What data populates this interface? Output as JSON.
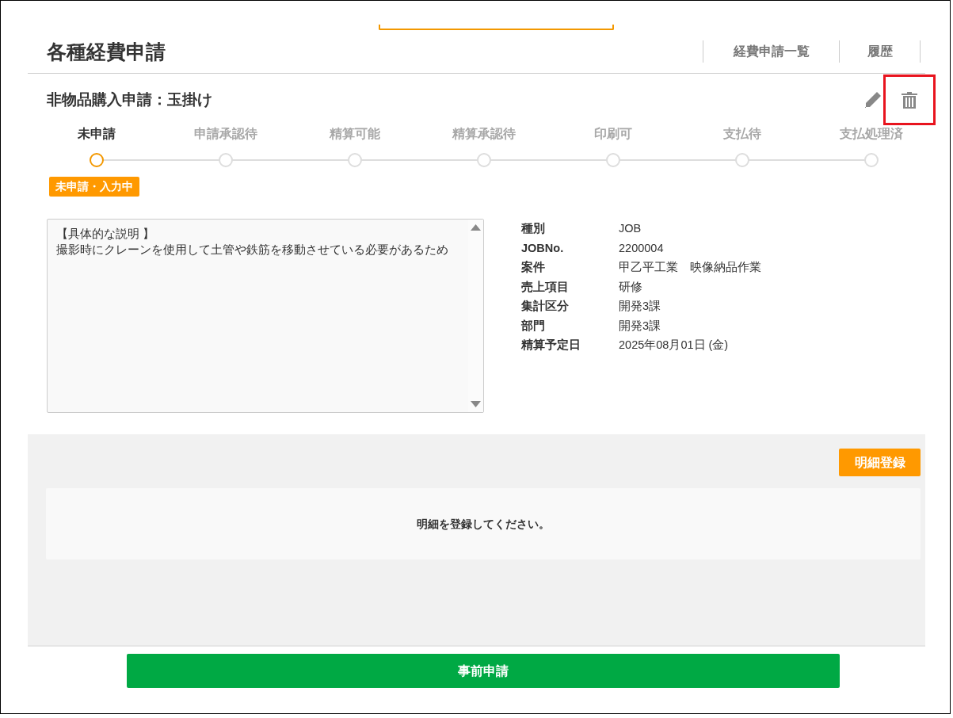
{
  "page": {
    "title": "各種経費申請",
    "nav_links": [
      {
        "label": "経費申請一覧"
      },
      {
        "label": "履歴"
      }
    ]
  },
  "application": {
    "title": "非物品購入申請：玉掛け",
    "actions": [
      {
        "kind": "edit",
        "highlighted": false
      },
      {
        "kind": "delete",
        "highlighted": true
      }
    ]
  },
  "steps": [
    {
      "label": "未申請",
      "active": true
    },
    {
      "label": "申請承認待",
      "active": false
    },
    {
      "label": "精算可能",
      "active": false
    },
    {
      "label": "精算承認待",
      "active": false
    },
    {
      "label": "印刷可",
      "active": false
    },
    {
      "label": "支払待",
      "active": false
    },
    {
      "label": "支払処理済",
      "active": false
    }
  ],
  "status_badge": {
    "label": "未申請・入力中"
  },
  "description": {
    "lines": [
      "【具体的な説明 】",
      "撮影時にクレーンを使用して土管や鉄筋を移動させている必要があるため"
    ]
  },
  "details": [
    {
      "label": "種別",
      "value": "JOB"
    },
    {
      "label": "JOBNo.",
      "value": "2200004"
    },
    {
      "label": "案件",
      "value": "甲乙平工業　映像納品作業"
    },
    {
      "label": "売上項目",
      "value": "研修"
    },
    {
      "label": "集計区分",
      "value": "開発3課"
    },
    {
      "label": "部門",
      "value": "開発3課"
    },
    {
      "label": "精算予定日",
      "value": "2025年08月01日 (金)"
    }
  ],
  "line_items": {
    "register_button": "明細登録",
    "empty_message": "明細を登録してください。"
  },
  "submit_button": "事前申請"
}
